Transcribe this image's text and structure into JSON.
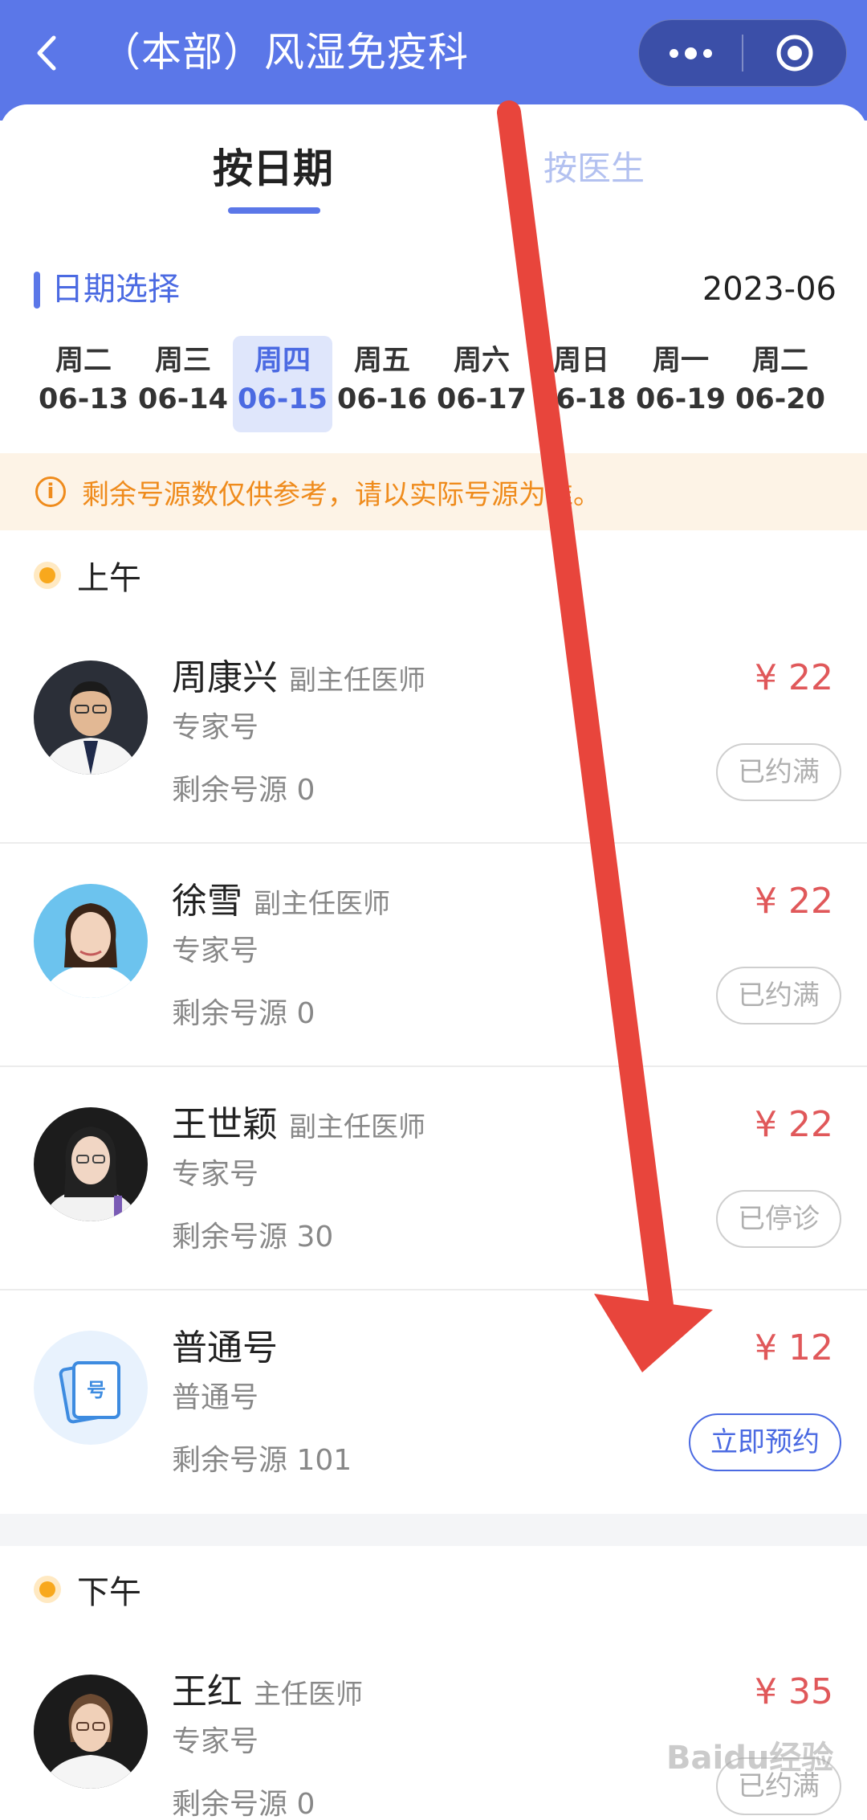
{
  "header": {
    "back_icon": "chevron-left-icon",
    "title": "（本部）风湿免疫科",
    "capsule": {
      "more_icon": "more-dots-icon",
      "close_icon": "target-circle-icon"
    },
    "background": "#5b77e8"
  },
  "tabs": [
    {
      "label": "按日期",
      "active": true
    },
    {
      "label": "按医生",
      "active": false
    }
  ],
  "date_section": {
    "label": "日期选择",
    "month": "2023-06",
    "days": [
      {
        "weekday": "周二",
        "date": "06-13"
      },
      {
        "weekday": "周三",
        "date": "06-14"
      },
      {
        "weekday": "周四",
        "date": "06-15",
        "selected": true
      },
      {
        "weekday": "周五",
        "date": "06-16"
      },
      {
        "weekday": "周六",
        "date": "06-17"
      },
      {
        "weekday": "周日",
        "date": "06-18"
      },
      {
        "weekday": "周一",
        "date": "06-19"
      },
      {
        "weekday": "周二",
        "date": "06-20"
      }
    ]
  },
  "notice": {
    "icon": "info-icon",
    "text": "剩余号源数仅供参考，请以实际号源为准。"
  },
  "morning": {
    "label": "上午",
    "rows": [
      {
        "name": "周康兴",
        "title": "副主任医师",
        "type": "专家号",
        "remain": "剩余号源 0",
        "price": "¥ 22",
        "status": "已约满"
      },
      {
        "name": "徐雪",
        "title": "副主任医师",
        "type": "专家号",
        "remain": "剩余号源 0",
        "price": "¥ 22",
        "status": "已约满"
      },
      {
        "name": "王世颖",
        "title": "副主任医师",
        "type": "专家号",
        "remain": "剩余号源 30",
        "price": "¥ 22",
        "status": "已停诊"
      },
      {
        "name": "普通号",
        "title": "",
        "type": "普通号",
        "remain": "剩余号源 101",
        "price": "¥ 12",
        "status": "立即预约",
        "icon_text": "号"
      }
    ]
  },
  "afternoon": {
    "label": "下午",
    "rows": [
      {
        "name": "王红",
        "title": "主任医师",
        "type": "专家号",
        "remain": "剩余号源 0",
        "price": "¥ 35",
        "status": "已约满"
      }
    ]
  },
  "watermark": "Baidu经验",
  "colors": {
    "accent": "#5b77e8",
    "price": "#e0585a",
    "notice": "#ef8b1c",
    "arrow": "#e8453c"
  }
}
